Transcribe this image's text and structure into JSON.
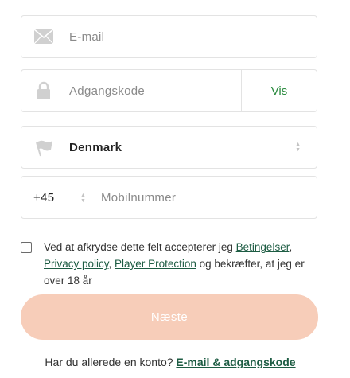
{
  "email": {
    "placeholder": "E-mail",
    "icon": "envelope-icon"
  },
  "password": {
    "placeholder": "Adgangskode",
    "icon": "lock-icon",
    "show_label": "Vis"
  },
  "country": {
    "value": "Denmark",
    "icon": "flag-icon"
  },
  "phone": {
    "prefix": "+45",
    "placeholder": "Mobilnummer"
  },
  "terms": {
    "text_before": "Ved at afkrydse dette felt accepterer jeg ",
    "link_terms": "Betingelser",
    "sep1": ", ",
    "link_privacy": "Privacy policy",
    "sep2": ", ",
    "link_player_protection": "Player Protection",
    "text_after": " og bekræfter, at jeg er over 18 år"
  },
  "next_button": {
    "label": "Næste"
  },
  "login": {
    "prompt": "Har du allerede en konto? ",
    "link": "E-mail & adgangskode"
  },
  "colors": {
    "accent_green": "#2a8a3e",
    "link_green": "#1d5c43",
    "button_disabled": "#f7cdb9",
    "border": "#e3e3e3"
  }
}
